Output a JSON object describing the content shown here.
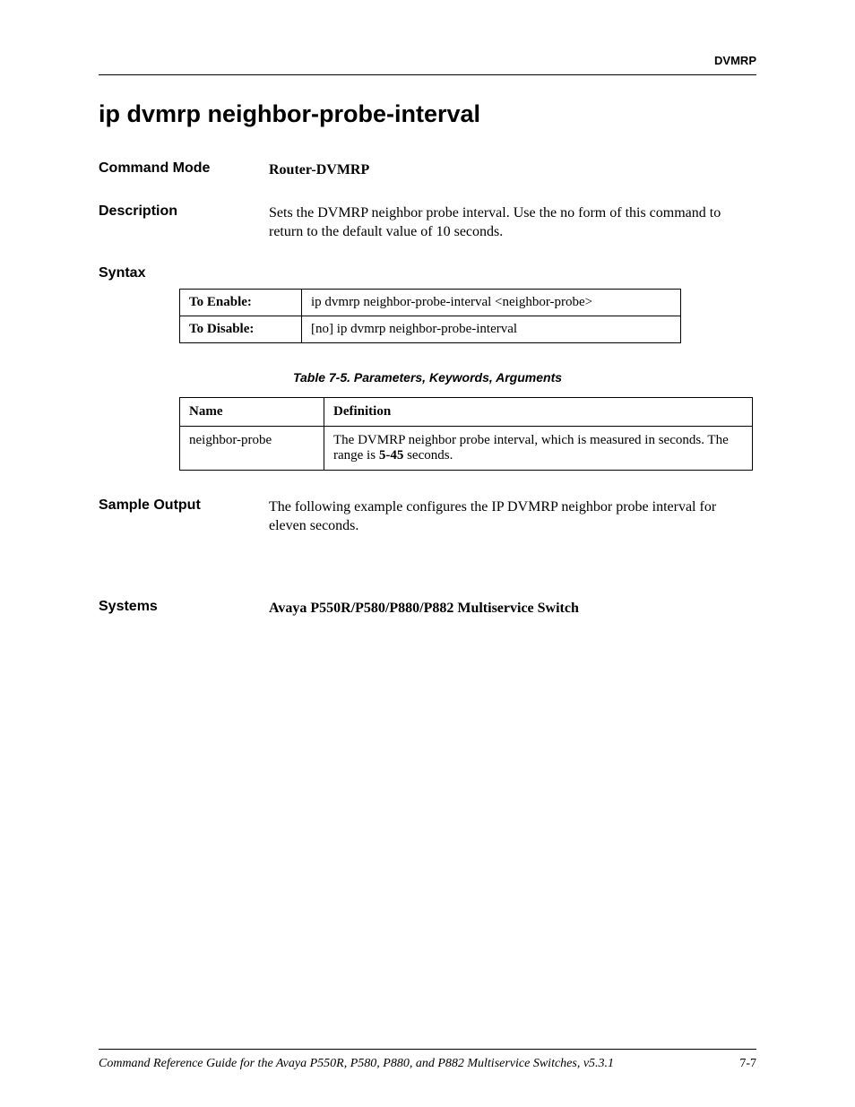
{
  "header": {
    "label": "DVMRP"
  },
  "title": "ip dvmrp neighbor-probe-interval",
  "sections": {
    "commandMode": {
      "label": "Command Mode",
      "value": "Router-DVMRP"
    },
    "description": {
      "label": "Description",
      "value": "Sets the DVMRP neighbor probe interval. Use the no form of this command to return to the default value of 10 seconds."
    },
    "syntax": {
      "label": "Syntax",
      "rows": [
        {
          "label": "To Enable:",
          "value": "ip dvmrp neighbor-probe-interval <neighbor-probe>"
        },
        {
          "label": "To Disable:",
          "value": "[no] ip dvmrp neighbor-probe-interval"
        }
      ],
      "caption": "Table 7-5.  Parameters, Keywords, Arguments",
      "paramsHeader": {
        "name": "Name",
        "definition": "Definition"
      },
      "params": [
        {
          "name": "neighbor-probe",
          "definitionPrefix": "The DVMRP neighbor probe interval, which is measured in seconds. The range is ",
          "range": "5-45",
          "definitionSuffix": " seconds."
        }
      ]
    },
    "sampleOutput": {
      "label": "Sample Output",
      "value": "The following example configures the IP DVMRP neighbor probe interval for eleven seconds."
    },
    "systems": {
      "label": "Systems",
      "value": "Avaya P550R/P580/P880/P882 Multiservice Switch"
    }
  },
  "footer": {
    "text": "Command Reference Guide for the Avaya P550R, P580, P880, and P882 Multiservice Switches, v5.3.1",
    "page": "7-7"
  }
}
